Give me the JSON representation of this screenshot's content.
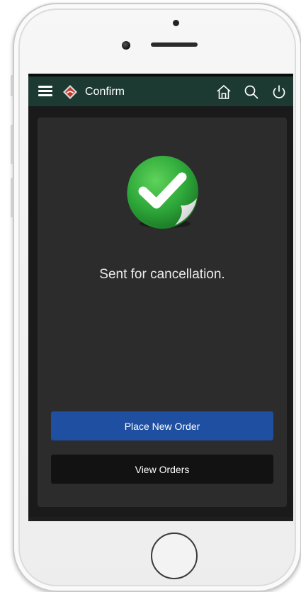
{
  "header": {
    "title": "Confirm",
    "menu_icon": "hamburger-menu-icon",
    "logo_icon": "brand-diamond-logo",
    "actions": [
      {
        "icon": "home-icon"
      },
      {
        "icon": "search-icon"
      },
      {
        "icon": "power-icon"
      }
    ]
  },
  "confirmation": {
    "icon": "green-checkmark-sticker-icon",
    "message": "Sent for cancellation."
  },
  "buttons": {
    "place_new_order": "Place New Order",
    "view_orders": "View Orders"
  },
  "colors": {
    "header_bg": "#1d3a32",
    "card_bg": "#2c2c2c",
    "primary_button": "#1f4fa0",
    "secondary_button": "#121212",
    "success_green": "#2ea83a"
  }
}
